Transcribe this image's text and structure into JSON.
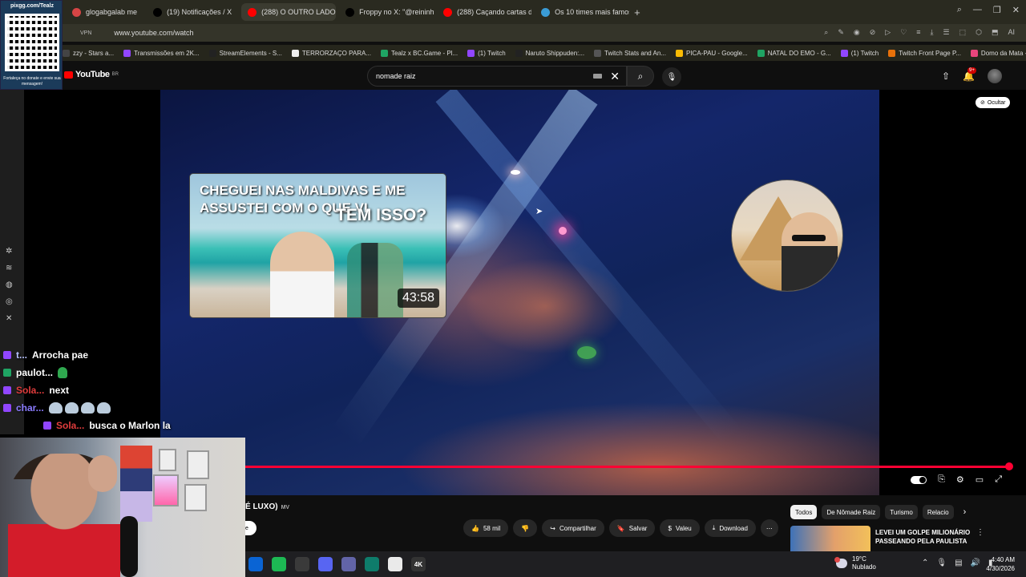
{
  "browser": {
    "tabs": [
      {
        "label": "glogabgalab me",
        "color": "#d64545",
        "active": false
      },
      {
        "label": "(19) Notificações / X",
        "color": "#000000",
        "active": false
      },
      {
        "label": "(288) O OUTRO LADO D",
        "color": "#ff0000",
        "active": true
      },
      {
        "label": "Froppy no X: \"@reininh",
        "color": "#000000",
        "active": false
      },
      {
        "label": "(288) Caçando cartas de",
        "color": "#ff0000",
        "active": false
      },
      {
        "label": "Os 10 times mais famos",
        "color": "#3a9bd5",
        "active": false
      }
    ],
    "new_tab": "+",
    "vpn_label": "VPN",
    "url": "www.youtube.com/watch",
    "bookmarks": [
      {
        "label": "zzy - Stars a...",
        "color": "#444"
      },
      {
        "label": "Transmissões em 2K...",
        "color": "#9146ff"
      },
      {
        "label": "StreamElements - S...",
        "color": "#222"
      },
      {
        "label": "TERRORZAÇO PARA...",
        "color": "#eee"
      },
      {
        "label": "Tealz x BC.Game - Pl...",
        "color": "#1fa463"
      },
      {
        "label": "(1) Twitch",
        "color": "#9146ff"
      },
      {
        "label": "Naruto Shippuden:...",
        "color": "#222"
      },
      {
        "label": "Twitch Stats and An...",
        "color": "#555"
      },
      {
        "label": "PICA-PAU - Google...",
        "color": "#fbbc04"
      },
      {
        "label": "NATAL DO EMO - G...",
        "color": "#1fa463"
      },
      {
        "label": "(1) Twitch",
        "color": "#9146ff"
      },
      {
        "label": "Twitch Front Page P...",
        "color": "#e8710a"
      },
      {
        "label": "Domo da Mata - Ho...",
        "color": "#e8457c"
      }
    ]
  },
  "youtube": {
    "logo_text": "YouTube",
    "region": "BR",
    "search_value": "nomade raiz",
    "notif_badge": "9+",
    "hide_label": "Ocultar",
    "endscreen": {
      "title": "CHEGUEI NAS MALDIVAS E ME ASSUSTEI COM O QUE VI",
      "overlay_text": "TEM ISSO?",
      "duration": "43:58"
    },
    "video_title": "É LUXO)",
    "video_title_badge": "MV",
    "subscribe_label": "e",
    "actions": {
      "like": "58 mil",
      "share": "Compartilhar",
      "save": "Salvar",
      "thanks": "Valeu",
      "download": "Download"
    },
    "chips": [
      "Todos",
      "De Nômade Raiz",
      "Turismo",
      "Relacio"
    ],
    "recommended": {
      "title": "LEVEI UM GOLPE MILIONÁRIO PASSEANDO PELA PAULISTA"
    }
  },
  "overlay": {
    "qr_title": "pixgg.com/Tealz",
    "qr_text": "Fortaleça no donate e envie sua mensagem!",
    "chat": [
      {
        "user": "t...",
        "text": "Arrocha pae",
        "user_color": "#b9c3ff",
        "icon": "#9146ff"
      },
      {
        "user": "paulot...",
        "text": "",
        "user_color": "#ffffff",
        "icon": "#1fa463"
      },
      {
        "user": "Sola...",
        "text": "next",
        "user_color": "#e03c3c",
        "icon": "#9146ff"
      },
      {
        "user": "char...",
        "text": "",
        "user_color": "#8b7cff",
        "icon": "#9146ff"
      },
      {
        "user": "Sola...",
        "text": "busca o Marlon la",
        "user_color": "#e03c3c",
        "icon": "#9146ff"
      }
    ]
  },
  "taskbar": {
    "weather_temp": "19°C",
    "weather_desc": "Nublado",
    "time": "4:40 AM",
    "date": "4/30/2026",
    "apps": [
      {
        "name": "outlook",
        "color": "#0a64d4",
        "glyph": ""
      },
      {
        "name": "spotify",
        "color": "#1db954",
        "glyph": ""
      },
      {
        "name": "app-red",
        "color": "#3a3a3a",
        "glyph": ""
      },
      {
        "name": "app-disc",
        "color": "#5865f2",
        "glyph": ""
      },
      {
        "name": "teams",
        "color": "#6264a7",
        "glyph": ""
      },
      {
        "name": "app-green",
        "color": "#0e7c6b",
        "glyph": ""
      },
      {
        "name": "chrome",
        "color": "#eaeaea",
        "glyph": ""
      },
      {
        "name": "4k",
        "color": "#333",
        "glyph": "4K"
      }
    ]
  }
}
